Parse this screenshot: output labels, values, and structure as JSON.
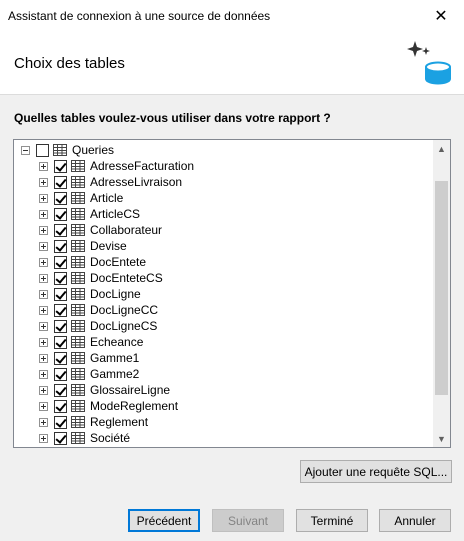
{
  "window": {
    "title": "Assistant de connexion à une source de données",
    "close_glyph": "✕"
  },
  "header": {
    "title": "Choix des tables",
    "icon": "database-sparkle-icon"
  },
  "question": "Quelles tables voulez-vous utiliser dans votre rapport ?",
  "tree": {
    "root": {
      "label": "Queries",
      "expanded": true,
      "checked": false
    },
    "items": [
      {
        "label": "AdresseFacturation",
        "checked": true
      },
      {
        "label": "AdresseLivraison",
        "checked": true
      },
      {
        "label": "Article",
        "checked": true
      },
      {
        "label": "ArticleCS",
        "checked": true
      },
      {
        "label": "Collaborateur",
        "checked": true
      },
      {
        "label": "Devise",
        "checked": true
      },
      {
        "label": "DocEntete",
        "checked": true
      },
      {
        "label": "DocEnteteCS",
        "checked": true
      },
      {
        "label": "DocLigne",
        "checked": true
      },
      {
        "label": "DocLigneCC",
        "checked": true
      },
      {
        "label": "DocLigneCS",
        "checked": true
      },
      {
        "label": "Echeance",
        "checked": true
      },
      {
        "label": "Gamme1",
        "checked": true
      },
      {
        "label": "Gamme2",
        "checked": true
      },
      {
        "label": "GlossaireLigne",
        "checked": true
      },
      {
        "label": "ModeReglement",
        "checked": true
      },
      {
        "label": "Reglement",
        "checked": true
      },
      {
        "label": "Société",
        "checked": true
      }
    ]
  },
  "buttons": {
    "add_query": "Ajouter une requête SQL...",
    "previous": "Précédent",
    "next": "Suivant",
    "finish": "Terminé",
    "cancel": "Annuler"
  },
  "colors": {
    "accent": "#0078d7",
    "db_icon": "#1ba1e2"
  }
}
